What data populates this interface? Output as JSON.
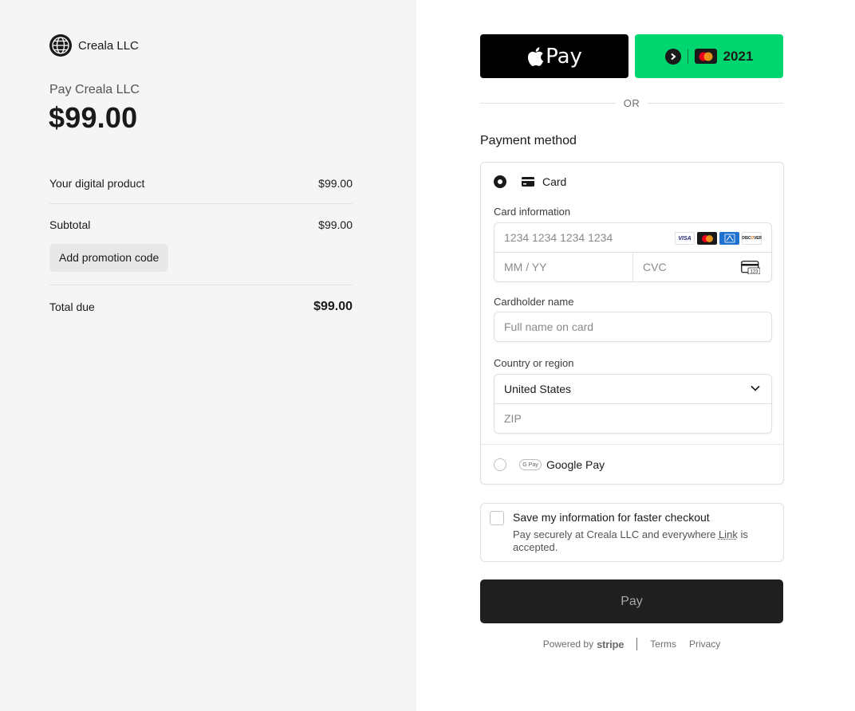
{
  "merchant": {
    "name": "Creala LLC",
    "logo_icon": "globe-icon",
    "pay_to": "Pay Creala LLC",
    "amount": "$99.00"
  },
  "summary": {
    "product_label": "Your digital product",
    "product_price": "$99.00",
    "subtotal_label": "Subtotal",
    "subtotal_value": "$99.00",
    "promo_label": "Add promotion code",
    "total_label": "Total due",
    "total_value": "$99.00"
  },
  "express": {
    "apple_pay_label": "Pay",
    "apple_icon": "apple-icon",
    "link_year": "2021",
    "link_icon": "link-arrow-icon",
    "link_color": "#00d66f"
  },
  "or_text": "OR",
  "payment_method": {
    "title": "Payment method",
    "card_label": "Card",
    "card_info_label": "Card information",
    "card_number_placeholder": "1234 1234 1234 1234",
    "card_brands": [
      "VISA",
      "MC",
      "AMEX",
      "DISCOVER"
    ],
    "expiry_placeholder": "MM / YY",
    "cvc_placeholder": "CVC",
    "cvc_icon_text": "123",
    "cardholder_label": "Cardholder name",
    "cardholder_placeholder": "Full name on card",
    "country_label": "Country or region",
    "country_value": "United States",
    "zip_placeholder": "ZIP",
    "gpay_badge": "G Pay",
    "gpay_label": "Google Pay"
  },
  "save_info": {
    "title": "Save my information for faster checkout",
    "desc_before": "Pay securely at Creala LLC and everywhere ",
    "desc_link": "Link",
    "desc_after": " is accepted."
  },
  "pay_button": "Pay",
  "footer": {
    "powered_by": "Powered by",
    "stripe": "stripe",
    "terms": "Terms",
    "privacy": "Privacy"
  }
}
